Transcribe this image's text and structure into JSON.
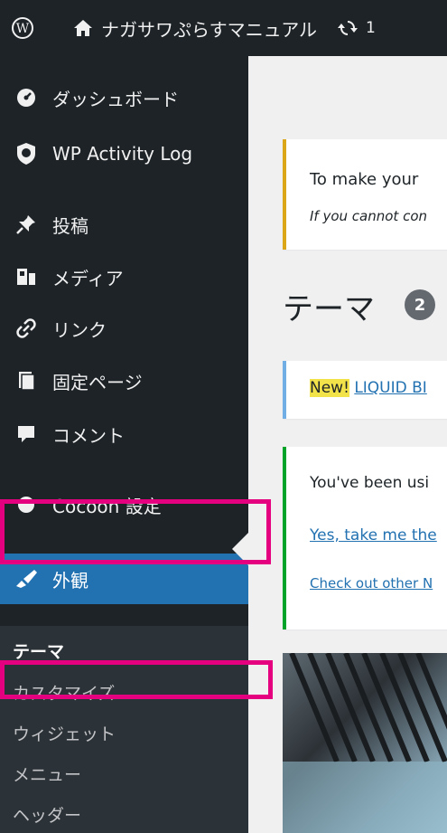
{
  "adminbar": {
    "site_name": "ナガサワぷらすマニュアル",
    "update_count": "1"
  },
  "sidebar": {
    "items": [
      {
        "label": "ダッシュボード",
        "icon": "dashboard-icon"
      },
      {
        "label": "WP Activity Log",
        "icon": "activity-log-icon"
      },
      {
        "label": "投稿",
        "icon": "pin-icon"
      },
      {
        "label": "メディア",
        "icon": "media-icon"
      },
      {
        "label": "リンク",
        "icon": "link-icon"
      },
      {
        "label": "固定ページ",
        "icon": "page-icon"
      },
      {
        "label": "コメント",
        "icon": "comment-icon"
      },
      {
        "label": "Cocoon 設定",
        "icon": "circle-icon"
      },
      {
        "label": "外観",
        "icon": "appearance-icon",
        "current": true
      }
    ],
    "submenu": [
      {
        "label": "テーマ",
        "current": true
      },
      {
        "label": "カスタマイズ"
      },
      {
        "label": "ウィジェット"
      },
      {
        "label": "メニュー"
      },
      {
        "label": "ヘッダー"
      }
    ]
  },
  "main": {
    "notice_warning": {
      "line1": "To make your",
      "line2": "If you cannot con"
    },
    "page_title": "テーマ",
    "theme_count": "2",
    "notice_info": {
      "new_label": "New!",
      "link_text": "LIQUID BI"
    },
    "notice_success": {
      "text": "You've been usi",
      "link1": "Yes, take me the",
      "link2": "Check out other N"
    }
  },
  "colors": {
    "sidebar_bg": "#1d2327",
    "submenu_bg": "#2c3338",
    "current_bg": "#2271b1",
    "highlight": "#e4007f"
  }
}
